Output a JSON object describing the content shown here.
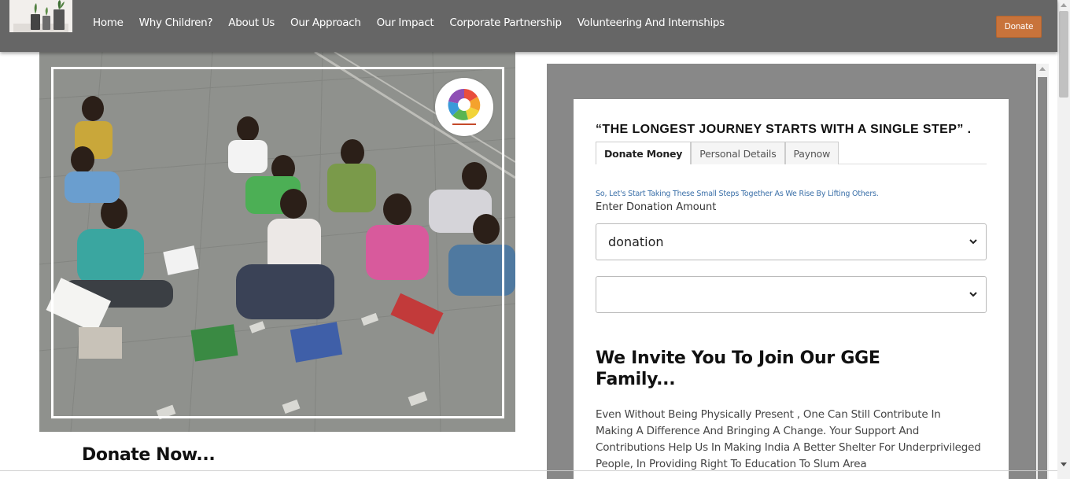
{
  "nav": {
    "links": [
      "Home",
      "Why Children?",
      "About Us",
      "Our Approach",
      "Our Impact",
      "Corporate Partnership",
      "Volunteering And Internships"
    ],
    "donate_label": "Donate",
    "logo_icon": "plant-pots-logo",
    "bg_color": "#666666",
    "donate_color": "#c8733b"
  },
  "hero": {
    "photo_icon": "children-studying-photo",
    "badge_icon": "organization-badge-logo",
    "heading": "Donate Now..."
  },
  "donation_panel": {
    "quote": "“THE LONGEST JOURNEY STARTS WITH A SINGLE STEP” .",
    "tabs": [
      "Donate Money",
      "Personal Details",
      "Paynow"
    ],
    "active_tab": "Donate Money",
    "tagline": "So, Let's Start Taking These Small Steps Together As We Rise By Lifting Others.",
    "amount_label": "Enter Donation Amount",
    "select_1_value": "donation",
    "select_2_value": "",
    "join_title": "We Invite You To Join Our GGE Family...",
    "join_text": "Even Without Being Physically Present , One Can Still Contribute In Making A Difference And Bringing A Change. Your Support And Contributions Help Us In Making India A Better Shelter For Underprivileged People, In Providing Right To Education To Slum Area",
    "panel_bg": "#888888",
    "tagline_color": "#3a6fa8"
  }
}
